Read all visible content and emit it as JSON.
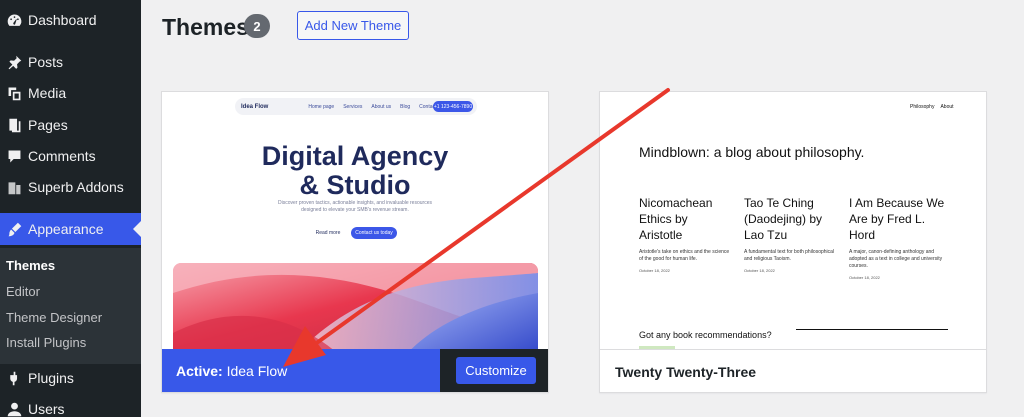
{
  "sidebar": {
    "items": [
      {
        "label": "Dashboard",
        "icon": "dashboard-icon"
      },
      {
        "label": "Posts",
        "icon": "pin-icon"
      },
      {
        "label": "Media",
        "icon": "media-icon"
      },
      {
        "label": "Pages",
        "icon": "pages-icon"
      },
      {
        "label": "Comments",
        "icon": "comment-icon"
      },
      {
        "label": "Superb Addons",
        "icon": "addons-icon"
      },
      {
        "label": "Appearance",
        "icon": "brush-icon"
      },
      {
        "label": "Plugins",
        "icon": "plug-icon"
      },
      {
        "label": "Users",
        "icon": "user-icon"
      }
    ],
    "submenu": [
      "Themes",
      "Editor",
      "Theme Designer",
      "Install Plugins"
    ]
  },
  "header": {
    "title": "Themes",
    "count": "2",
    "add_button": "Add New Theme"
  },
  "theme1": {
    "nav_logo": "Idea Flow",
    "nav_links": [
      "Home page",
      "Services",
      "About us",
      "Blog",
      "Contact"
    ],
    "nav_phone": "+1 123-456-7890",
    "hero_line1": "Digital Agency",
    "hero_line2": "& Studio",
    "hero_sub": "Discover proven tactics, actionable insights, and invaluable resources designed to elevate your SMB's revenue stream.",
    "btn_read": "Read more",
    "btn_contact": "Contact us today",
    "active_prefix": "Active:",
    "active_name": "Idea Flow",
    "customize": "Customize"
  },
  "theme2": {
    "nav": [
      "Philosophy",
      "About"
    ],
    "title": "Mindblown: a blog about philosophy.",
    "posts": [
      {
        "title": "Nicomachean Ethics by Aristotle",
        "excerpt": "Aristotle's take on ethics and the science of the good for human life.",
        "date": "October 18, 2022"
      },
      {
        "title": "Tao Te Ching (Daodejing) by Lao Tzu",
        "excerpt": "A fundamental text for both philosophical and religious Taoism.",
        "date": "October 18, 2022"
      },
      {
        "title": "I Am Because We Are by Fred L. Hord",
        "excerpt": "A major, canon-defining anthology and adopted as a text in college and university courses.",
        "date": "October 18, 2022"
      }
    ],
    "recommend": "Got any book recommendations?",
    "name": "Twenty Twenty-Three"
  },
  "colors": {
    "sidebar_bg": "#1d2327",
    "accent": "#3858e9",
    "arrow": "#e8382c"
  }
}
